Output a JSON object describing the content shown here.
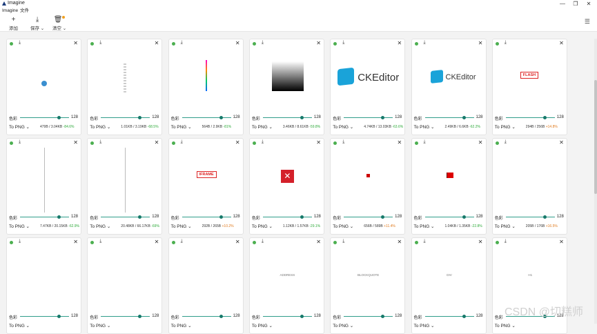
{
  "app": {
    "title": "Imagine",
    "menus": [
      "Imagine",
      "文件"
    ]
  },
  "window_buttons": [
    "—",
    "❐",
    "✕"
  ],
  "toolbar": {
    "add": {
      "icon": "plus-icon",
      "label": "添加"
    },
    "save": {
      "icon": "download-icon",
      "label": "保存 ⌄"
    },
    "clear": {
      "icon": "trash-icon",
      "label": "清空 ⌄"
    },
    "settings_icon": "settings-sliders-icon"
  },
  "common": {
    "color_label": "色彩",
    "slider_value": "128"
  },
  "cards": [
    {
      "format": "To PNG ⌄",
      "sizes": "479B / 3.04KB",
      "pct": "-84.6%",
      "dir": "down",
      "preview": "circle-plus"
    },
    {
      "format": "To PNG ⌄",
      "sizes": "1.01KB / 3.19KB",
      "pct": "-68.5%",
      "dir": "down",
      "preview": "checker-strip"
    },
    {
      "format": "To PNG ⌄",
      "sizes": "564B / 2.9KB",
      "pct": "-81%",
      "dir": "down",
      "preview": "rainbow-line"
    },
    {
      "format": "To PNG ⌄",
      "sizes": "3.46KB / 8.61KB",
      "pct": "-59.8%",
      "dir": "down",
      "preview": "gradient"
    },
    {
      "format": "To PNG ⌄",
      "sizes": "4.74KB / 13.03KB",
      "pct": "-63.6%",
      "dir": "down",
      "preview": "ckeditor-large",
      "text": "CKEditor"
    },
    {
      "format": "To PNG ⌄",
      "sizes": "2.49KB / 6.6KB",
      "pct": "-62.2%",
      "dir": "down",
      "preview": "ckeditor-small",
      "text": "CKEditor"
    },
    {
      "format": "To PNG ⌄",
      "sizes": "294B / 256B",
      "pct": "+14.8%",
      "dir": "up",
      "preview": "label-box",
      "text": "FLASH"
    },
    {
      "format": "To PNG ⌄",
      "sizes": "7.47KB / 20.15KB",
      "pct": "-62.9%",
      "dir": "down",
      "preview": "vline"
    },
    {
      "format": "To PNG ⌄",
      "sizes": "20.48KB / 66.17KB",
      "pct": "-69%",
      "dir": "down",
      "preview": "vline"
    },
    {
      "format": "To PNG ⌄",
      "sizes": "292B / 265B",
      "pct": "+10.2%",
      "dir": "up",
      "preview": "label-box",
      "text": "IFRAME"
    },
    {
      "format": "To PNG ⌄",
      "sizes": "1.12KB / 1.57KB",
      "pct": "-29.1%",
      "dir": "down",
      "preview": "red-x"
    },
    {
      "format": "To PNG ⌄",
      "sizes": "656B / 589B",
      "pct": "+11.4%",
      "dir": "up",
      "preview": "flag-small"
    },
    {
      "format": "To PNG ⌄",
      "sizes": "1.04KB / 1.35KB",
      "pct": "-22.8%",
      "dir": "down",
      "preview": "flag-large"
    },
    {
      "format": "To PNG ⌄",
      "sizes": "205B / 176B",
      "pct": "+16.5%",
      "dir": "up",
      "preview": "empty"
    },
    {
      "format": "To PNG ⌄",
      "sizes": "",
      "pct": "",
      "dir": "down",
      "preview": "empty"
    },
    {
      "format": "To PNG ⌄",
      "sizes": "",
      "pct": "",
      "dir": "down",
      "preview": "empty"
    },
    {
      "format": "To PNG ⌄",
      "sizes": "",
      "pct": "",
      "dir": "down",
      "preview": "empty"
    },
    {
      "format": "To PNG ⌄",
      "sizes": "",
      "pct": "",
      "dir": "down",
      "preview": "small-text",
      "text": "ADDRESS"
    },
    {
      "format": "To PNG ⌄",
      "sizes": "",
      "pct": "",
      "dir": "down",
      "preview": "small-text",
      "text": "BLOCKQUOTE"
    },
    {
      "format": "To PNG ⌄",
      "sizes": "",
      "pct": "",
      "dir": "down",
      "preview": "small-text",
      "text": "DIV"
    },
    {
      "format": "To PNG ⌄",
      "sizes": "",
      "pct": "",
      "dir": "down",
      "preview": "small-text",
      "text": "H1"
    }
  ],
  "watermark": "CSDN @切糕师"
}
